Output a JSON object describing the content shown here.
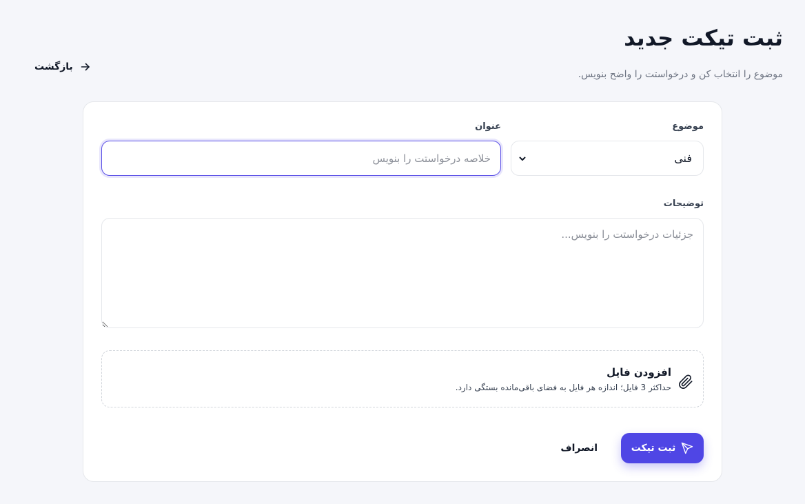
{
  "header": {
    "title": "ثبت تیکت جدید",
    "subtitle": "موضوع را انتخاب کن و درخواستت را واضح بنویس.",
    "back_label": "بازگشت",
    "back_icon": "arrow-right-icon"
  },
  "form": {
    "subject": {
      "label": "موضوع",
      "value": "فنی",
      "chevron_icon": "chevron-down-icon"
    },
    "title": {
      "label": "عنوان",
      "value": "",
      "placeholder": "خلاصه درخواستت را بنویس"
    },
    "description": {
      "label": "توضیحات",
      "value": "",
      "placeholder": "جزئیات درخواستت را بنویس..."
    },
    "attachment": {
      "title": "افزودن فایل",
      "hint": "حداکثر 3 فایل؛ اندازه هر فایل به فضای باقی‌مانده بستگی دارد.",
      "icon": "paperclip-icon"
    },
    "actions": {
      "submit_label": "ثبت تیکت",
      "submit_icon": "send-icon",
      "cancel_label": "انصراف"
    }
  },
  "colors": {
    "accent": "#4f46e5",
    "background": "#f5f6fa",
    "card": "#ffffff",
    "border": "#e5e7eb"
  }
}
